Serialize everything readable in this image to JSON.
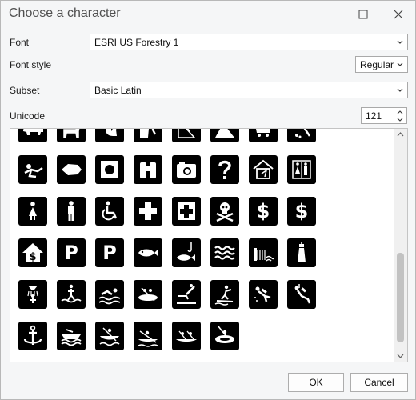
{
  "window": {
    "title": "Choose a character"
  },
  "form": {
    "font_label": "Font",
    "font_value": "ESRI US Forestry 1",
    "style_label": "Font style",
    "style_value": "Regular",
    "subset_label": "Subset",
    "subset_value": "Basic Latin",
    "unicode_label": "Unicode",
    "unicode_value": "121"
  },
  "grid": {
    "selected_index": 46,
    "glyphs": [
      {
        "name": "bear-icon"
      },
      {
        "name": "deer-icon"
      },
      {
        "name": "squirrel-icon"
      },
      {
        "name": "rock-climbing-icon"
      },
      {
        "name": "climber-icon"
      },
      {
        "name": "rockfall-icon"
      },
      {
        "name": "mine-cart-icon"
      },
      {
        "name": "mining-pick-icon"
      },
      {
        "name": "crawl-tunnel-icon"
      },
      {
        "name": "arrowhead-icon"
      },
      {
        "name": "target-square-icon"
      },
      {
        "name": "binoculars-icon"
      },
      {
        "name": "camera-icon"
      },
      {
        "name": "information-question-icon"
      },
      {
        "name": "ranger-station-icon"
      },
      {
        "name": "restrooms-icon"
      },
      {
        "name": "women-icon"
      },
      {
        "name": "men-icon"
      },
      {
        "name": "wheelchair-accessible-icon"
      },
      {
        "name": "first-aid-cross-icon"
      },
      {
        "name": "hospital-cross-icon"
      },
      {
        "name": "poison-skull-icon"
      },
      {
        "name": "fee-dollar-icon",
        "text": "$"
      },
      {
        "name": "fee-dollar-alt-icon",
        "text": "$"
      },
      {
        "name": "house-fee-icon"
      },
      {
        "name": "parking-round-icon",
        "text": "P"
      },
      {
        "name": "parking-serif-icon",
        "text": "P"
      },
      {
        "name": "fish-hatchery-icon"
      },
      {
        "name": "fishing-icon"
      },
      {
        "name": "water-waves-icon"
      },
      {
        "name": "dam-icon"
      },
      {
        "name": "lighthouse-icon"
      },
      {
        "name": "shower-icon"
      },
      {
        "name": "wading-icon"
      },
      {
        "name": "swimming-icon"
      },
      {
        "name": "rafting-icon"
      },
      {
        "name": "diving-icon"
      },
      {
        "name": "water-skiing-icon"
      },
      {
        "name": "scuba-diving-icon"
      },
      {
        "name": "snorkeling-icon"
      },
      {
        "name": "anchor-icon"
      },
      {
        "name": "ski-boat-icon"
      },
      {
        "name": "canoeing-icon"
      },
      {
        "name": "rowing-icon"
      },
      {
        "name": "canoe-group-icon"
      },
      {
        "name": "kayaking-icon"
      }
    ]
  },
  "buttons": {
    "ok": "OK",
    "cancel": "Cancel"
  },
  "colors": {
    "dialog_bg": "#f5f6f7",
    "glyph_bg": "#000000",
    "selection": "#d6d6d6"
  }
}
